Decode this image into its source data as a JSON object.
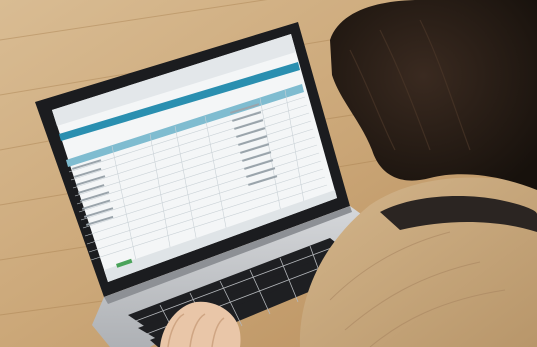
{
  "scene": {
    "subject": "person-using-laptop",
    "setting": "wooden-table",
    "screen_content": "spreadsheet-application"
  },
  "colors": {
    "wood_light": "#d8b88c",
    "wood_mid": "#c9a273",
    "wood_dark": "#a97e4e",
    "laptop_bezel": "#1b1c1f",
    "keyboard_base": "#c7c9cc",
    "keys": "#1e1f22",
    "sweater": "#c6a77d",
    "hair": "#2a1f18",
    "skin": "#e9c6a8",
    "screen_bg": "#f4f6f7",
    "screen_accent": "#2a8fb0"
  },
  "screen": {
    "status_text": ""
  }
}
